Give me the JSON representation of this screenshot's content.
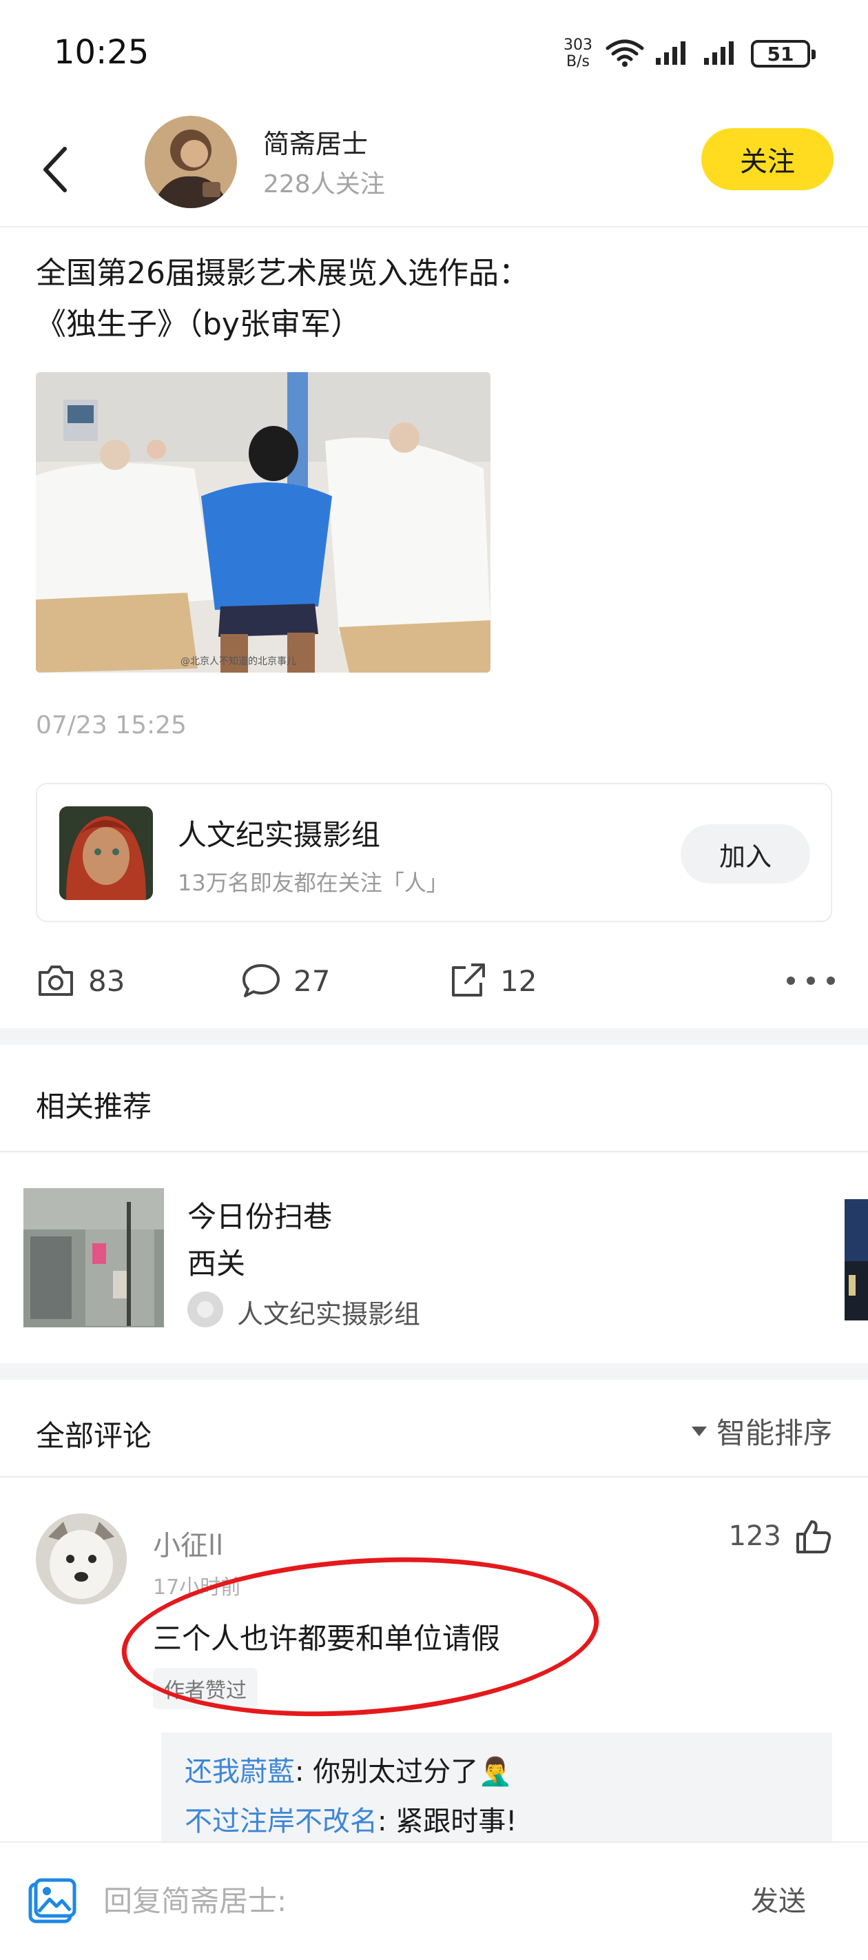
{
  "status_bar": {
    "time": "10:25",
    "net_speed_value": "303",
    "net_speed_unit": "B/s",
    "battery": "51"
  },
  "header": {
    "author_name": "简斋居士",
    "followers": "228人关注",
    "follow_label": "关注"
  },
  "post": {
    "title_line1": "全国第26届摄影艺术展览入选作品：",
    "title_line2": "《独生子》（by张审军）",
    "image_watermark": "@北京人不知道的北京事儿",
    "time": "07/23 15:25"
  },
  "group": {
    "name": "人文纪实摄影组",
    "desc": "13万名即友都在关注「人」",
    "join_label": "加入"
  },
  "actions": {
    "photos": "83",
    "comments": "27",
    "shares": "12"
  },
  "related": {
    "title": "相关推荐",
    "item": {
      "title1": "今日份扫巷",
      "title2": "西关",
      "group": "人文纪实摄影组"
    }
  },
  "comments": {
    "title": "全部评论",
    "sort_label": "智能排序",
    "items": [
      {
        "user": "小征ll",
        "time": "17小时前",
        "likes": "123",
        "text": "三个人也许都要和单位请假",
        "badge": "作者赞过",
        "replies": [
          {
            "name": "还我蔚藍",
            "text": ": 你别太过分了🤦‍♂️"
          },
          {
            "name": "不过注岸不改名",
            "text": ": 紧跟时事!"
          }
        ]
      }
    ]
  },
  "composer": {
    "placeholder": "回复简斋居士:",
    "send_label": "发送"
  },
  "colors": {
    "accent_yellow": "#ffdc1f",
    "reply_name_blue": "#3d86d6",
    "annotation_red": "#e5191c",
    "image_icon_blue": "#1e88e5"
  }
}
